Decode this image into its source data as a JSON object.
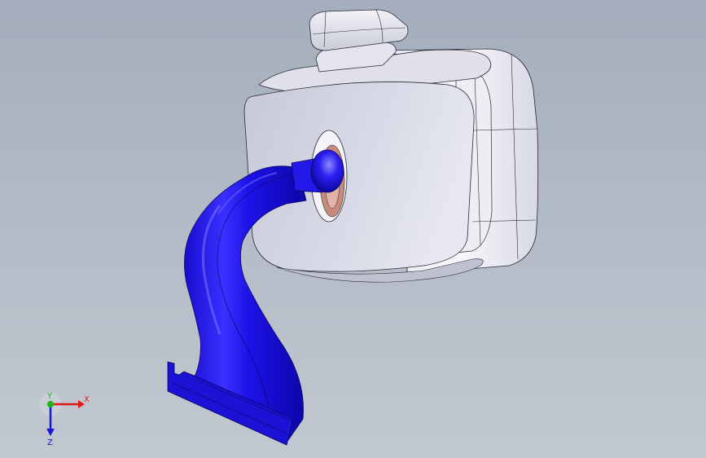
{
  "viewport": {
    "background_top": "#a4adbb",
    "background_bottom": "#c2c8d0"
  },
  "model": {
    "housing_color": "#d4d6e4",
    "housing_face_color": "#c6c8d8",
    "stem_color": "#1a10e0",
    "stem_highlight": "#6f68ff",
    "inner_socket_color": "#c98a7c",
    "edge_color": "#2a2a35"
  },
  "triad": {
    "x_label": "X",
    "y_label": "Y",
    "z_label": "Z",
    "x_color": "#e01818",
    "y_color": "#18b818",
    "z_color": "#1818d8"
  }
}
